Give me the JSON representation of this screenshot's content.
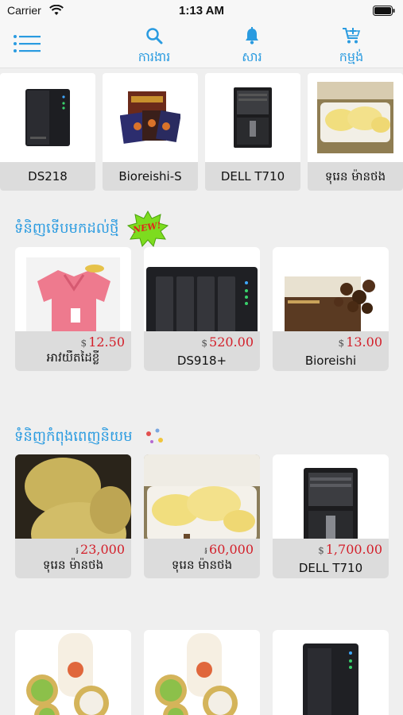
{
  "status_bar": {
    "carrier": "Carrier",
    "time": "1:13 AM"
  },
  "nav": {
    "search_label": "ការងារ",
    "notify_label": "សារ",
    "cart_label": "កម្មង់"
  },
  "recent": [
    {
      "name": "DS218"
    },
    {
      "name": "Bioreishi-S"
    },
    {
      "name": "DELL T710"
    },
    {
      "name": "ទុរេន ម៉ានថង"
    }
  ],
  "sections": {
    "new_title": "ទំនិញទើបមកដល់ថ្មី",
    "new_badge": "NEW!",
    "promo_title": "ទំនិញកំពុងពេញនិយម"
  },
  "new_products": [
    {
      "currency": "$",
      "price": "12.50",
      "name": "អាវយឺតដៃខ្លី"
    },
    {
      "currency": "$",
      "price": "520.00",
      "name": "DS918+"
    },
    {
      "currency": "$",
      "price": "13.00",
      "name": "Bioreishi"
    }
  ],
  "popular_products": [
    {
      "currency": "៛",
      "price": "23,000",
      "name": "ទុរេន ម៉ានថង"
    },
    {
      "currency": "៛",
      "price": "60,000",
      "name": "ទុរេន ម៉ានថង"
    },
    {
      "currency": "$",
      "price": "1,700.00",
      "name": "DELL T710"
    }
  ],
  "colors": {
    "accent": "#2a9be0",
    "price": "#d31f2a",
    "footer": "#dcdcdc",
    "background": "#efefef"
  }
}
